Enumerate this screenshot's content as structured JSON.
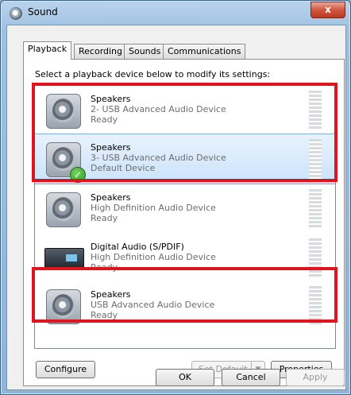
{
  "window": {
    "title": "Sound",
    "close_glyph": "x"
  },
  "tabs": [
    {
      "label": "Playback",
      "active": true
    },
    {
      "label": "Recording",
      "active": false
    },
    {
      "label": "Sounds",
      "active": false
    },
    {
      "label": "Communications",
      "active": false
    }
  ],
  "playback": {
    "instruction": "Select a playback device below to modify its settings:",
    "devices": [
      {
        "icon": "speaker-icon",
        "name": "Speakers",
        "description": "2- USB Advanced Audio Device",
        "status": "Ready",
        "selected": false
      },
      {
        "icon": "speaker-icon",
        "name": "Speakers",
        "description": "3- USB Advanced Audio Device",
        "status": "Default Device",
        "selected": true,
        "default_badge": "checkmark-icon"
      },
      {
        "icon": "speaker-icon",
        "name": "Speakers",
        "description": "High Definition Audio Device",
        "status": "Ready",
        "selected": false
      },
      {
        "icon": "digital-audio-receiver-icon",
        "name": "Digital Audio (S/PDIF)",
        "description": "High Definition Audio Device",
        "status": "Ready",
        "selected": false
      },
      {
        "icon": "speaker-icon",
        "name": "Speakers",
        "description": "USB Advanced Audio Device",
        "status": "Ready",
        "selected": false
      }
    ],
    "buttons": {
      "configure": "Configure",
      "set_default": "Set Default",
      "set_default_arrow": "▼",
      "properties": "Properties"
    }
  },
  "dialog_buttons": {
    "ok": "OK",
    "cancel": "Cancel",
    "apply": "Apply"
  },
  "colors": {
    "highlight": "#e0141e",
    "selection": "#cbe3fa"
  }
}
